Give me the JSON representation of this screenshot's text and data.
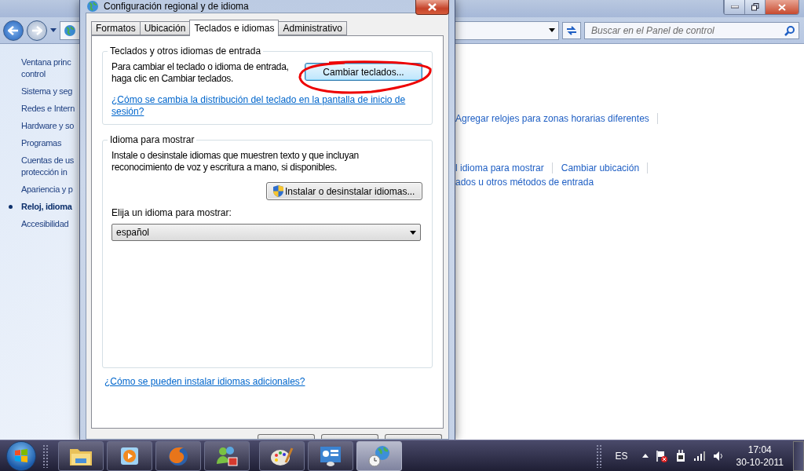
{
  "control_panel": {
    "search": {
      "placeholder": "Buscar en el Panel de control"
    },
    "sidebar": {
      "items": [
        {
          "lines": [
            "Ventana princ",
            "control"
          ],
          "selected": false
        },
        {
          "lines": [
            "Sistema y seg"
          ],
          "selected": false
        },
        {
          "lines": [
            "Redes e Intern"
          ],
          "selected": false
        },
        {
          "lines": [
            "Hardware y so"
          ],
          "selected": false
        },
        {
          "lines": [
            "Programas"
          ],
          "selected": false
        },
        {
          "lines": [
            "Cuentas de us",
            "protección in"
          ],
          "selected": false
        },
        {
          "lines": [
            "Apariencia y p"
          ],
          "selected": false
        },
        {
          "lines": [
            "Reloj, idioma"
          ],
          "selected": true
        },
        {
          "lines": [
            "Accesibilidad"
          ],
          "selected": false
        }
      ]
    },
    "content_links": [
      [
        "Agregar relojes para zonas horarias diferentes"
      ],
      [
        "l idioma para mostrar",
        "Cambiar ubicación"
      ],
      [
        "ados u otros métodos de entrada"
      ]
    ]
  },
  "dialog": {
    "title": "Configuración regional y de idioma",
    "tabs": [
      {
        "label": "Formatos",
        "selected": false
      },
      {
        "label": "Ubicación",
        "selected": false
      },
      {
        "label": "Teclados e idiomas",
        "selected": true
      },
      {
        "label": "Administrativo",
        "selected": false
      }
    ],
    "keyboards_group": {
      "title": "Teclados y otros idiomas de entrada",
      "text": "Para cambiar el teclado o idioma de entrada, haga clic en Cambiar teclados.",
      "button": "Cambiar teclados...",
      "link": "¿Cómo se cambia la distribución del teclado en la pantalla de inicio de sesión?"
    },
    "display_group": {
      "title": "Idioma para mostrar",
      "text": "Instale o desinstale idiomas que muestren texto y que incluyan reconocimiento de voz y escritura a mano, si disponibles.",
      "button": "Instalar o desinstalar idiomas...",
      "select_label": "Elija un idioma para mostrar:",
      "select_value": "español"
    },
    "bottom_link": "¿Cómo se pueden instalar idiomas adicionales?"
  },
  "taskbar": {
    "apps": [
      {
        "kind": "folder",
        "selected": false
      },
      {
        "kind": "media",
        "selected": false
      },
      {
        "kind": "browser",
        "selected": false
      },
      {
        "kind": "messenger",
        "selected": false
      },
      {
        "kind": "paint",
        "selected": false
      },
      {
        "kind": "panel",
        "selected": false
      },
      {
        "kind": "globe",
        "selected": true
      }
    ],
    "language": "ES",
    "time": "17:04",
    "date": "30-10-2011"
  }
}
